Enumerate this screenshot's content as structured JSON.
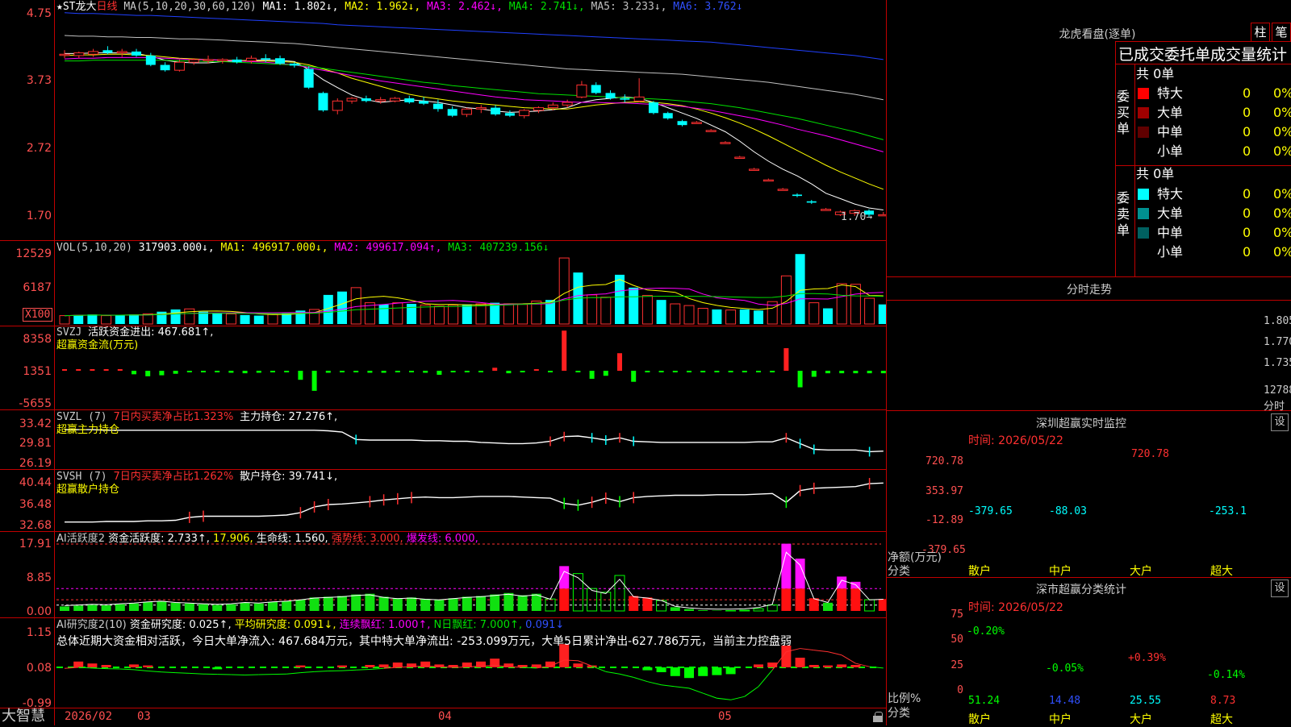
{
  "main_chart": {
    "stock_title": "★ST龙大",
    "period": "日线",
    "ma_params": "MA(5,10,20,30,60,120)",
    "ma_values": [
      "MA1: 1.802↓,",
      "MA2: 1.962↓,",
      "MA3: 2.462↓,",
      "MA4: 2.741↓,",
      "MA5: 3.233↓,",
      "MA6: 3.762↓"
    ],
    "ma_colors": [
      "#ffffff",
      "#ffff00",
      "#ff00ff",
      "#00e000",
      "#c0c0c0",
      "#2040ff"
    ],
    "y_labels": [
      "4.75",
      "3.73",
      "2.72",
      "1.70"
    ],
    "last_label": "1.70",
    "candles": [
      {
        "o": 4.12,
        "h": 4.18,
        "l": 4.06,
        "c": 4.12
      },
      {
        "o": 4.1,
        "h": 4.16,
        "l": 4.06,
        "c": 4.14
      },
      {
        "o": 4.12,
        "h": 4.2,
        "l": 4.08,
        "c": 4.16
      },
      {
        "o": 4.18,
        "h": 4.24,
        "l": 4.12,
        "c": 4.14
      },
      {
        "o": 4.14,
        "h": 4.2,
        "l": 4.08,
        "c": 4.16
      },
      {
        "o": 4.16,
        "h": 4.2,
        "l": 4.08,
        "c": 4.1
      },
      {
        "o": 4.1,
        "h": 4.14,
        "l": 3.94,
        "c": 3.96
      },
      {
        "o": 3.96,
        "h": 4.0,
        "l": 3.86,
        "c": 3.88
      },
      {
        "o": 3.88,
        "h": 4.04,
        "l": 3.86,
        "c": 4.0
      },
      {
        "o": 4.0,
        "h": 4.06,
        "l": 3.96,
        "c": 4.04
      },
      {
        "o": 4.04,
        "h": 4.1,
        "l": 3.98,
        "c": 4.04
      },
      {
        "o": 4.02,
        "h": 4.06,
        "l": 3.98,
        "c": 4.04
      },
      {
        "o": 4.04,
        "h": 4.08,
        "l": 3.98,
        "c": 4.0
      },
      {
        "o": 4.02,
        "h": 4.1,
        "l": 3.98,
        "c": 4.06
      },
      {
        "o": 4.06,
        "h": 4.12,
        "l": 4.0,
        "c": 4.04
      },
      {
        "o": 4.06,
        "h": 4.1,
        "l": 3.96,
        "c": 3.98
      },
      {
        "o": 3.98,
        "h": 4.0,
        "l": 3.92,
        "c": 3.95
      },
      {
        "o": 3.9,
        "h": 3.94,
        "l": 3.6,
        "c": 3.62
      },
      {
        "o": 3.54,
        "h": 3.56,
        "l": 3.26,
        "c": 3.28
      },
      {
        "o": 3.28,
        "h": 3.46,
        "l": 3.22,
        "c": 3.42
      },
      {
        "o": 3.42,
        "h": 3.48,
        "l": 3.38,
        "c": 3.46
      },
      {
        "o": 3.46,
        "h": 3.5,
        "l": 3.4,
        "c": 3.42
      },
      {
        "o": 3.42,
        "h": 3.48,
        "l": 3.38,
        "c": 3.44
      },
      {
        "o": 3.42,
        "h": 3.48,
        "l": 3.4,
        "c": 3.46
      },
      {
        "o": 3.46,
        "h": 3.5,
        "l": 3.38,
        "c": 3.4
      },
      {
        "o": 3.42,
        "h": 3.48,
        "l": 3.36,
        "c": 3.38
      },
      {
        "o": 3.38,
        "h": 3.44,
        "l": 3.26,
        "c": 3.3
      },
      {
        "o": 3.3,
        "h": 3.34,
        "l": 3.18,
        "c": 3.2
      },
      {
        "o": 3.22,
        "h": 3.32,
        "l": 3.18,
        "c": 3.3
      },
      {
        "o": 3.3,
        "h": 3.36,
        "l": 3.24,
        "c": 3.32
      },
      {
        "o": 3.32,
        "h": 3.36,
        "l": 3.2,
        "c": 3.22
      },
      {
        "o": 3.24,
        "h": 3.28,
        "l": 3.18,
        "c": 3.2
      },
      {
        "o": 3.2,
        "h": 3.3,
        "l": 3.16,
        "c": 3.28
      },
      {
        "o": 3.28,
        "h": 3.34,
        "l": 3.24,
        "c": 3.32
      },
      {
        "o": 3.32,
        "h": 3.4,
        "l": 3.28,
        "c": 3.36
      },
      {
        "o": 3.36,
        "h": 3.44,
        "l": 3.32,
        "c": 3.4
      },
      {
        "o": 3.48,
        "h": 3.72,
        "l": 3.46,
        "c": 3.66
      },
      {
        "o": 3.66,
        "h": 3.7,
        "l": 3.52,
        "c": 3.54
      },
      {
        "o": 3.54,
        "h": 3.58,
        "l": 3.44,
        "c": 3.46
      },
      {
        "o": 3.46,
        "h": 3.52,
        "l": 3.4,
        "c": 3.44
      },
      {
        "o": 3.42,
        "h": 3.76,
        "l": 3.4,
        "c": 3.48
      },
      {
        "o": 3.4,
        "h": 3.42,
        "l": 3.22,
        "c": 3.24
      },
      {
        "o": 3.24,
        "h": 3.26,
        "l": 3.14,
        "c": 3.16
      },
      {
        "o": 3.12,
        "h": 3.14,
        "l": 3.04,
        "c": 3.06
      },
      {
        "o": 3.1,
        "h": 3.12,
        "l": 3.08,
        "c": 3.1
      },
      {
        "o": 2.98,
        "h": 3.0,
        "l": 2.96,
        "c": 2.98
      },
      {
        "o": 2.8,
        "h": 2.82,
        "l": 2.78,
        "c": 2.8
      },
      {
        "o": 2.58,
        "h": 2.6,
        "l": 2.56,
        "c": 2.58
      },
      {
        "o": 2.4,
        "h": 2.42,
        "l": 2.38,
        "c": 2.4
      },
      {
        "o": 2.24,
        "h": 2.26,
        "l": 2.22,
        "c": 2.24
      },
      {
        "o": 2.1,
        "h": 2.12,
        "l": 2.08,
        "c": 2.1
      },
      {
        "o": 2.02,
        "h": 2.04,
        "l": 1.98,
        "c": 2.0
      },
      {
        "o": 1.92,
        "h": 1.94,
        "l": 1.88,
        "c": 1.9
      },
      {
        "o": 1.8,
        "h": 1.82,
        "l": 1.78,
        "c": 1.8
      },
      {
        "o": 1.72,
        "h": 1.78,
        "l": 1.7,
        "c": 1.76
      },
      {
        "o": 1.74,
        "h": 1.8,
        "l": 1.7,
        "c": 1.78
      },
      {
        "o": 1.78,
        "h": 1.8,
        "l": 1.68,
        "c": 1.72
      },
      {
        "o": 1.72,
        "h": 1.76,
        "l": 1.7,
        "c": 1.72
      }
    ],
    "ma_series": {
      "MA1": [
        4.13,
        4.13,
        4.14,
        4.14,
        4.14,
        4.13,
        4.09,
        4.03,
        4.0,
        3.99,
        3.99,
        4.01,
        4.02,
        4.03,
        4.03,
        4.03,
        4.01,
        3.89,
        3.74,
        3.62,
        3.51,
        3.44,
        3.4,
        3.42,
        3.44,
        3.42,
        3.4,
        3.36,
        3.32,
        3.3,
        3.27,
        3.25,
        3.26,
        3.27,
        3.29,
        3.32,
        3.4,
        3.44,
        3.46,
        3.48,
        3.46,
        3.4,
        3.32,
        3.24,
        3.16,
        3.06,
        2.96,
        2.82,
        2.66,
        2.52,
        2.4,
        2.3,
        2.18,
        2.04,
        1.96,
        1.88,
        1.82,
        1.79
      ],
      "MA2": [
        4.1,
        4.11,
        4.11,
        4.12,
        4.12,
        4.11,
        4.1,
        4.08,
        4.06,
        4.05,
        4.04,
        4.03,
        4.03,
        4.02,
        4.02,
        4.01,
        4.0,
        3.96,
        3.9,
        3.84,
        3.76,
        3.7,
        3.64,
        3.58,
        3.52,
        3.48,
        3.45,
        3.42,
        3.4,
        3.38,
        3.36,
        3.34,
        3.32,
        3.31,
        3.3,
        3.3,
        3.33,
        3.36,
        3.38,
        3.4,
        3.41,
        3.4,
        3.38,
        3.35,
        3.3,
        3.24,
        3.17,
        3.09,
        3.0,
        2.9,
        2.79,
        2.68,
        2.57,
        2.46,
        2.36,
        2.27,
        2.18,
        2.1
      ],
      "MA3": [
        4.05,
        4.06,
        4.06,
        4.07,
        4.07,
        4.07,
        4.07,
        4.06,
        4.05,
        4.04,
        4.04,
        4.03,
        4.02,
        4.01,
        4.0,
        3.98,
        3.96,
        3.92,
        3.88,
        3.84,
        3.8,
        3.76,
        3.72,
        3.69,
        3.66,
        3.63,
        3.6,
        3.57,
        3.54,
        3.51,
        3.48,
        3.46,
        3.44,
        3.43,
        3.42,
        3.41,
        3.4,
        3.4,
        3.39,
        3.39,
        3.38,
        3.37,
        3.36,
        3.34,
        3.31,
        3.28,
        3.24,
        3.2,
        3.16,
        3.11,
        3.06,
        3.0,
        2.95,
        2.9,
        2.84,
        2.78,
        2.72,
        2.66
      ],
      "MA4": [
        4.02,
        4.02,
        4.03,
        4.03,
        4.03,
        4.03,
        4.03,
        4.03,
        4.02,
        4.02,
        4.01,
        4.01,
        4.0,
        3.99,
        3.98,
        3.97,
        3.96,
        3.94,
        3.91,
        3.88,
        3.85,
        3.82,
        3.79,
        3.76,
        3.73,
        3.7,
        3.68,
        3.65,
        3.63,
        3.61,
        3.59,
        3.57,
        3.55,
        3.53,
        3.52,
        3.51,
        3.5,
        3.49,
        3.48,
        3.47,
        3.46,
        3.45,
        3.44,
        3.42,
        3.4,
        3.38,
        3.35,
        3.32,
        3.28,
        3.24,
        3.2,
        3.16,
        3.11,
        3.06,
        3.01,
        2.96,
        2.9,
        2.84
      ],
      "MA5": [
        4.4,
        4.39,
        4.39,
        4.38,
        4.38,
        4.37,
        4.37,
        4.36,
        4.35,
        4.35,
        4.34,
        4.33,
        4.32,
        4.31,
        4.3,
        4.29,
        4.28,
        4.26,
        4.24,
        4.22,
        4.2,
        4.18,
        4.16,
        4.14,
        4.12,
        4.1,
        4.08,
        4.06,
        4.04,
        4.02,
        4.0,
        3.98,
        3.96,
        3.94,
        3.92,
        3.9,
        3.89,
        3.88,
        3.87,
        3.86,
        3.85,
        3.84,
        3.83,
        3.82,
        3.8,
        3.78,
        3.76,
        3.74,
        3.72,
        3.7,
        3.67,
        3.64,
        3.61,
        3.58,
        3.55,
        3.52,
        3.48,
        3.44
      ],
      "MA6": [
        4.74,
        4.73,
        4.73,
        4.72,
        4.71,
        4.7,
        4.7,
        4.69,
        4.68,
        4.67,
        4.66,
        4.65,
        4.64,
        4.63,
        4.62,
        4.61,
        4.6,
        4.59,
        4.58,
        4.56,
        4.55,
        4.54,
        4.53,
        4.52,
        4.51,
        4.5,
        4.49,
        4.48,
        4.47,
        4.46,
        4.45,
        4.44,
        4.43,
        4.42,
        4.41,
        4.4,
        4.39,
        4.38,
        4.37,
        4.36,
        4.35,
        4.34,
        4.33,
        4.32,
        4.31,
        4.3,
        4.28,
        4.26,
        4.24,
        4.22,
        4.2,
        4.18,
        4.16,
        4.14,
        4.12,
        4.1,
        4.07,
        4.04
      ]
    }
  },
  "vol_panel": {
    "label": "VOL(5,10,20)",
    "value": "317903.000↓,",
    "ma1": "MA1: 496917.000↓,",
    "ma2": "MA2: 499617.094↑,",
    "ma3": "MA3: 407239.156↓",
    "y_labels": [
      "12529",
      "6187"
    ],
    "unit": "X100",
    "bars": [
      1500,
      1600,
      1700,
      1500,
      1600,
      1700,
      1800,
      2200,
      2600,
      2700,
      2200,
      1900,
      1800,
      1600,
      1500,
      1700,
      2000,
      2400,
      2600,
      5200,
      5800,
      6500,
      3800,
      3500,
      3800,
      3600,
      3400,
      3200,
      3400,
      3500,
      3600,
      3800,
      3600,
      3500,
      4100,
      4300,
      11800,
      9200,
      5200,
      4800,
      8800,
      6500,
      5100,
      4300,
      3600,
      3300,
      2800,
      2600,
      2500,
      2600,
      2400,
      4000,
      8600,
      12500,
      3800,
      2800,
      7200,
      7100,
      4600,
      3500
    ]
  },
  "svzj_panel": {
    "label": "SVZJ",
    "title": "活跃资金进出: 467.681↑,",
    "subtitle": "超赢资金流(万元)",
    "y_labels": [
      "8358",
      "1351",
      "-5655"
    ],
    "bars": [
      200,
      120,
      80,
      60,
      40,
      -700,
      -1100,
      -900,
      -600,
      -200,
      -200,
      -300,
      -400,
      -500,
      -400,
      -300,
      -200,
      -1800,
      -4000,
      -400,
      -300,
      -200,
      -400,
      -400,
      -300,
      -300,
      -400,
      -800,
      -200,
      -200,
      -100,
      600,
      -500,
      -200,
      300,
      -300,
      8000,
      -200,
      -1600,
      -1000,
      3500,
      -2200,
      -200,
      -200,
      -100,
      -100,
      -100,
      -100,
      -100,
      -100,
      -100,
      -100,
      4500,
      -3300,
      -1200,
      -500,
      -500,
      -500,
      -500,
      -500
    ]
  },
  "svzl_panel": {
    "label": "SVZL",
    "params": "(7)",
    "title": "7日内买卖净占比1.323%",
    "holding": "主力持仓: 27.276↑,",
    "subtitle": "超赢主力持仓",
    "y_labels": [
      "33.42",
      "29.81",
      "26.19"
    ],
    "line": [
      31.6,
      31.6,
      31.6,
      31.5,
      31.5,
      31.5,
      31.5,
      31.5,
      31.5,
      31.5,
      31.5,
      31.5,
      31.5,
      31.5,
      31.5,
      31.5,
      31.5,
      31.5,
      31.5,
      31.4,
      31.2,
      29.9,
      29.8,
      29.8,
      29.8,
      29.8,
      29.7,
      29.7,
      29.6,
      29.6,
      29.4,
      29.3,
      29.2,
      29.2,
      29.3,
      29.6,
      30.4,
      30.5,
      30.2,
      29.8,
      30.2,
      29.6,
      29.5,
      29.4,
      29.4,
      29.4,
      29.4,
      29.4,
      29.4,
      29.4,
      29.5,
      29.5,
      30.2,
      29.2,
      28.2,
      28.1,
      28.1,
      28.1,
      27.8,
      27.9
    ]
  },
  "svsh_panel": {
    "label": "SVSH",
    "params": "(7)",
    "title": "7日内买卖净占比1.262%",
    "holding": "散户持仓: 39.741↓,",
    "subtitle": "超赢散户持仓",
    "y_labels": [
      "40.44",
      "36.48",
      "32.68"
    ],
    "line": [
      33.0,
      33.0,
      33.0,
      33.1,
      33.1,
      33.1,
      33.2,
      33.2,
      33.3,
      33.8,
      34.0,
      34.0,
      34.0,
      34.0,
      34.0,
      34.1,
      34.2,
      34.6,
      35.6,
      36.0,
      36.1,
      36.3,
      36.5,
      36.8,
      37.0,
      37.2,
      37.3,
      37.2,
      37.2,
      37.3,
      37.4,
      37.4,
      37.4,
      37.3,
      37.2,
      37.1,
      36.2,
      35.9,
      36.4,
      37.1,
      36.5,
      37.2,
      37.4,
      37.5,
      37.6,
      37.6,
      37.6,
      37.7,
      37.7,
      37.7,
      37.8,
      37.9,
      36.4,
      38.4,
      38.8,
      38.9,
      39.0,
      39.1,
      39.6,
      39.7
    ]
  },
  "ai2_panel": {
    "label": "AI活跃度2",
    "act": "资金活跃度: 2.733↑,",
    "v2": "17.906,",
    "life": "生命线: 1.560,",
    "strong": "强势线: 3.000,",
    "burst": "爆发线: 6.000,",
    "y_labels": [
      "17.91",
      "8.85",
      "0.00"
    ],
    "bars": [
      1.2,
      1.4,
      1.6,
      1.5,
      1.8,
      2.0,
      2.4,
      2.6,
      2.2,
      2.0,
      1.8,
      1.6,
      1.8,
      2.2,
      2.0,
      2.4,
      2.6,
      3.0,
      3.6,
      3.8,
      4.0,
      4.4,
      4.6,
      3.8,
      3.4,
      3.6,
      3.2,
      3.0,
      3.4,
      3.8,
      4.0,
      4.4,
      4.8,
      4.2,
      4.6,
      3.2,
      12.0,
      10.0,
      6.0,
      5.0,
      9.5,
      4.0,
      3.6,
      2.8,
      1.0,
      0.5,
      0.2,
      0.1,
      0.1,
      0.2,
      0.6,
      1.6,
      18.0,
      14.0,
      3.4,
      2.2,
      9.2,
      7.8,
      3.0,
      3.2
    ],
    "hollow_idx": [
      35,
      37,
      38,
      39,
      40,
      43,
      48,
      49,
      50,
      51,
      58
    ]
  },
  "ai_research_panel": {
    "label": "AI研究度2(10)",
    "research": "资金研究度: 0.025↑,",
    "avg": "平均研究度: 0.091↓,",
    "streak": "连续飘红: 1.000↑,",
    "nday": "N日飘红: 7.000↑,",
    "extra": "0.091↓",
    "summary": "总体近期大资金相对活跃，今日大单净流入: 467.684万元，其中特大单净流出: -253.099万元，大单5日累计净出-627.786万元，当前主力控盘弱",
    "y_labels": [
      "1.15",
      "0.08",
      "-0.99"
    ],
    "bars": [
      0.03,
      0.12,
      0.08,
      0.05,
      0.02,
      0.06,
      0.04,
      0.03,
      0.02,
      -0.02,
      -0.03,
      -0.04,
      -0.02,
      -0.03,
      -0.02,
      -0.02,
      -0.03,
      0.04,
      -0.02,
      0.03,
      0.04,
      0.03,
      0.05,
      0.06,
      0.1,
      0.08,
      0.12,
      0.06,
      0.05,
      0.1,
      0.12,
      0.18,
      0.08,
      0.05,
      0.06,
      0.12,
      0.48,
      0.08,
      0.04,
      0.03,
      0.02,
      -0.03,
      -0.06,
      -0.1,
      -0.18,
      -0.22,
      -0.18,
      -0.16,
      -0.14,
      0.02,
      0.06,
      0.1,
      0.45,
      0.2,
      0.05,
      0.04,
      0.06,
      0.05,
      0.03,
      0.02
    ],
    "line": [
      0.05,
      0.08,
      0.06,
      0.04,
      0.03,
      0.01,
      -0.03,
      -0.06,
      -0.08,
      -0.1,
      -0.12,
      -0.13,
      -0.14,
      -0.15,
      -0.14,
      -0.13,
      -0.12,
      -0.08,
      -0.05,
      -0.03,
      -0.02,
      0.0,
      0.02,
      0.05,
      0.08,
      0.1,
      0.12,
      0.1,
      0.08,
      0.09,
      0.12,
      0.14,
      0.1,
      0.08,
      0.06,
      0.12,
      0.3,
      0.28,
      0.12,
      -0.05,
      -0.12,
      -0.22,
      -0.35,
      -0.45,
      -0.5,
      -0.55,
      -0.7,
      -0.85,
      -0.9,
      -0.8,
      -0.5,
      0.0,
      0.55,
      0.65,
      0.6,
      0.55,
      0.45,
      0.2,
      0.1,
      0.06
    ]
  },
  "time_axis": {
    "brand": "大智慧",
    "labels": [
      "2026/02",
      "03",
      "04",
      "05"
    ]
  },
  "order_panel": {
    "title": "龙虎看盘(逐单)",
    "btn_bar": "柱",
    "btn_pen": "笔",
    "heading": "已成交委托单成交量统计",
    "buy_label": "委买单",
    "sell_label": "委卖单",
    "buy_total": "共 0单",
    "sell_total": "共 0单",
    "buy_rows": [
      {
        "name": "特大",
        "vol": "0",
        "pct": "0%",
        "color": "#ff0000"
      },
      {
        "name": "大单",
        "vol": "0",
        "pct": "0%",
        "color": "#a00000"
      },
      {
        "name": "中单",
        "vol": "0",
        "pct": "0%",
        "color": "#600000"
      },
      {
        "name": "小单",
        "vol": "0",
        "pct": "0%",
        "color": ""
      }
    ],
    "sell_rows": [
      {
        "name": "特大",
        "vol": "0",
        "pct": "0%",
        "color": "#00ffff"
      },
      {
        "name": "大单",
        "vol": "0",
        "pct": "0%",
        "color": "#009090"
      },
      {
        "name": "中单",
        "vol": "0",
        "pct": "0%",
        "color": "#006060"
      },
      {
        "name": "小单",
        "vol": "0",
        "pct": "0%",
        "color": ""
      }
    ]
  },
  "intraday": {
    "title": "分时走势",
    "y_labels": [
      "1.805",
      "1.770",
      "1.735"
    ],
    "vol_label": "12788",
    "footer": "分时"
  },
  "sz_monitor": {
    "title": "深圳超赢实时监控",
    "settings": "设",
    "time": "时间: 2026/05/22",
    "y_labels": [
      "720.78",
      "353.97",
      "-12.89",
      "-379.65"
    ],
    "unit_label": "净额(万元)",
    "cat_label": "分类",
    "cats": [
      "散户",
      "中户",
      "大户",
      "超大"
    ],
    "values": [
      -379.65,
      -88.03,
      720.78,
      -253.1
    ],
    "value_labels": [
      "-379.65",
      "-88.03",
      "720.78",
      "-253.1"
    ]
  },
  "sz_stats": {
    "title": "深市超赢分类统计",
    "settings": "设",
    "time": "时间: 2026/05/22",
    "y_labels": [
      "75",
      "50",
      "25",
      "0"
    ],
    "unit_label": "比例%",
    "cat_label": "分类",
    "cats": [
      "散户",
      "中户",
      "大户",
      "超大"
    ],
    "pct": [
      51.24,
      14.48,
      25.55,
      8.73
    ],
    "pct_labels": [
      "51.24",
      "14.48",
      "25.55",
      "8.73"
    ],
    "changes": [
      "-0.20%",
      "-0.05%",
      "+0.39%",
      "-0.14%"
    ]
  }
}
